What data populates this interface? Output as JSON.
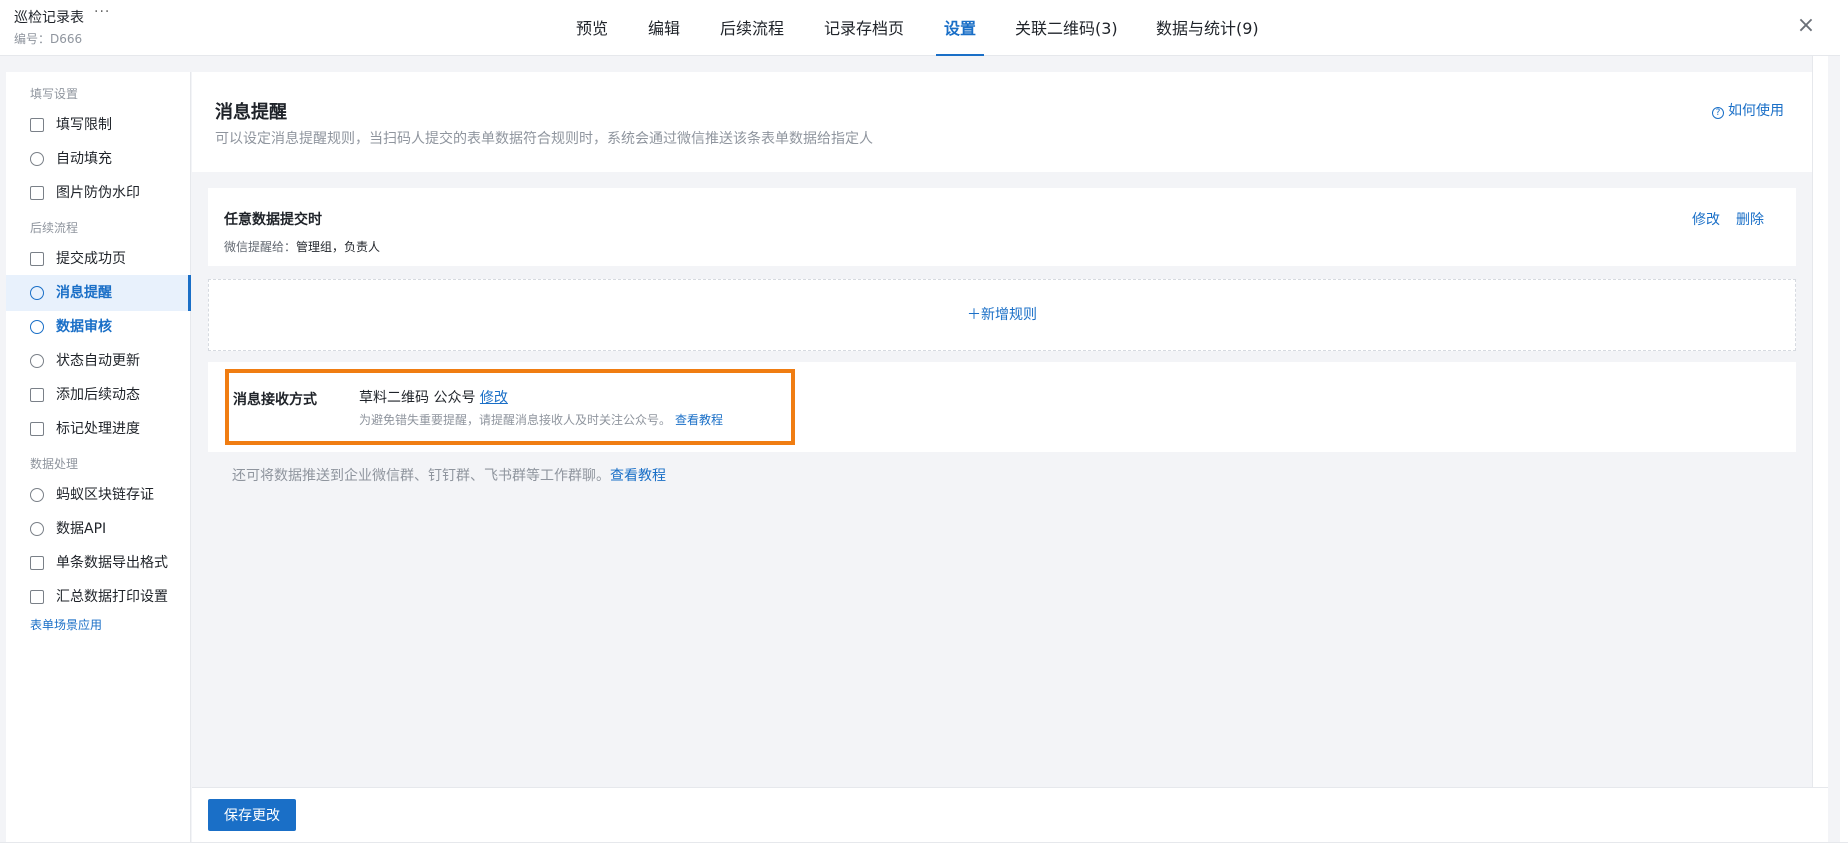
{
  "header": {
    "title": "巡检记录表",
    "more": "···",
    "code": "编号：D666",
    "tabs": [
      "预览",
      "编辑",
      "后续流程",
      "记录存档页",
      "设置",
      "关联二维码(3)",
      "数据与统计(9)"
    ],
    "active_tab": "设置",
    "close": "×"
  },
  "sidebar": {
    "groups": [
      "填写设置",
      "后续流程",
      "数据处理"
    ],
    "items": [
      {
        "label": "填写限制",
        "icon": "edit-icon"
      },
      {
        "label": "自动填充",
        "icon": "rocket-icon"
      },
      {
        "label": "图片防伪水印",
        "icon": "image-icon"
      },
      {
        "label": "提交成功页",
        "icon": "check-page-icon"
      },
      {
        "label": "消息提醒",
        "icon": "bell-icon"
      },
      {
        "label": "数据审核",
        "icon": "user-check-icon"
      },
      {
        "label": "状态自动更新",
        "icon": "clock-icon"
      },
      {
        "label": "添加后续动态",
        "icon": "document-icon"
      },
      {
        "label": "标记处理进度",
        "icon": "refresh-icon"
      },
      {
        "label": "蚂蚁区块链存证",
        "icon": "blockchain-icon"
      },
      {
        "label": "数据API",
        "icon": "link-icon"
      },
      {
        "label": "单条数据导出格式",
        "icon": "file-icon"
      },
      {
        "label": "汇总数据打印设置",
        "icon": "printer-icon"
      }
    ],
    "active_item": "消息提醒",
    "footer_link": "表单场景应用"
  },
  "main": {
    "title": "消息提醒",
    "description": "可以设定消息提醒规则，当扫码人提交的表单数据符合规则时，系统会通过微信推送该条表单数据给指定人",
    "howto": "如何使用",
    "rule": {
      "title": "任意数据提交时",
      "sub_label": "微信提醒给：",
      "sub_value": "管理组，负责人",
      "edit": "修改",
      "delete": "删除"
    },
    "add_rule": "＋新增规则",
    "receive": {
      "label": "消息接收方式",
      "value": "草料二维码 公众号",
      "edit": "修改",
      "hint": "为避免错失重要提醒，请提醒消息接收人及时关注公众号。",
      "hint_link": "查看教程"
    },
    "push_note": "还可将数据推送到企业微信群、钉钉群、飞书群等工作群聊。",
    "push_link": "查看教程"
  },
  "footer": {
    "save": "保存更改"
  },
  "colors": {
    "accent": "#1a6fc7",
    "highlight_box": "#f07d12"
  }
}
